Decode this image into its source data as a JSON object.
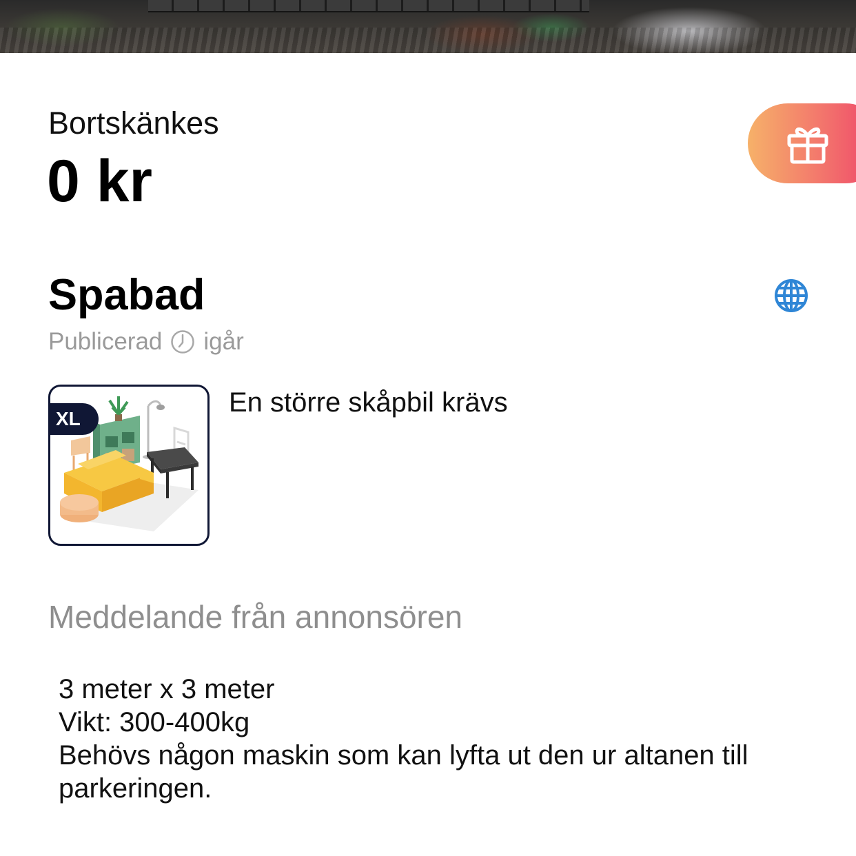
{
  "listing": {
    "price_label": "Bortskänkes",
    "price": "0 kr",
    "title": "Spabad",
    "published_label": "Publicerad",
    "published_time": "igår",
    "size_badge": "XL",
    "vehicle_requirement": "En större skåpbil krävs",
    "message_heading": "Meddelande från annonsören",
    "description_lines": [
      "3 meter x 3 meter",
      "Vikt: 300-400kg",
      "Behövs någon maskin som kan lyfta ut den ur altanen till parkeringen."
    ]
  },
  "icons": {
    "gift": "gift-icon",
    "globe": "globe-icon",
    "clock": "clock-icon"
  },
  "colors": {
    "gift_gradient_start": "#f6b169",
    "gift_gradient_end": "#ee3f6a",
    "globe_blue": "#2f86d6",
    "badge_navy": "#101735",
    "muted_text": "#9a9a9a"
  }
}
